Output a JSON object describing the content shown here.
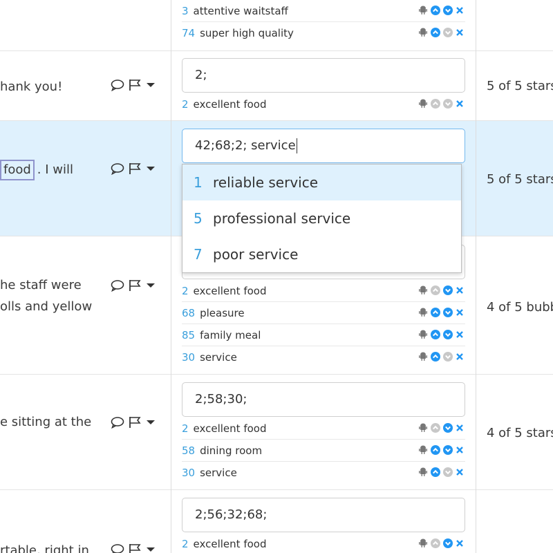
{
  "colors": {
    "accent": "#2196f3",
    "number": "#3a9fdc",
    "highlight_row": "#dff1fd",
    "disabled": "#c8c8c8",
    "remove": "#2196f3"
  },
  "top_tags": [
    {
      "num": "3",
      "label": "attentive waitstaff",
      "up": true,
      "down": true
    },
    {
      "num": "74",
      "label": "super high quality",
      "up": true,
      "down": false
    }
  ],
  "rows": [
    {
      "review_lines": [
        "hank you!"
      ],
      "input_value": "2;",
      "tags": [
        {
          "num": "2",
          "label": "excellent food",
          "up": false,
          "down": false
        }
      ],
      "rating": "5 of 5 stars"
    },
    {
      "review_lines": [
        "food",
        ". I will"
      ],
      "input_value": "42;68;2; service",
      "tags": [],
      "rating": "5 of 5 stars"
    },
    {
      "review_lines": [
        "he staff were",
        "olls and yellow"
      ],
      "input_value": "",
      "tags": [
        {
          "num": "2",
          "label": "excellent food",
          "up": false,
          "down": true
        },
        {
          "num": "68",
          "label": "pleasure",
          "up": true,
          "down": true
        },
        {
          "num": "85",
          "label": "family meal",
          "up": true,
          "down": true
        },
        {
          "num": "30",
          "label": "service",
          "up": true,
          "down": false
        }
      ],
      "rating": "4 of 5 bubb"
    },
    {
      "review_lines": [
        "e sitting at the"
      ],
      "input_value": "2;58;30;",
      "tags": [
        {
          "num": "2",
          "label": "excellent food",
          "up": false,
          "down": true
        },
        {
          "num": "58",
          "label": "dining room",
          "up": true,
          "down": true
        },
        {
          "num": "30",
          "label": "service",
          "up": true,
          "down": false
        }
      ],
      "rating": "4 of 5 stars"
    },
    {
      "review_lines": [
        "rtable, right in"
      ],
      "input_value": "2;56;32;68;",
      "tags": [
        {
          "num": "2",
          "label": "excellent food",
          "up": false,
          "down": true
        }
      ],
      "rating": ""
    }
  ],
  "autocomplete": [
    {
      "num": "1",
      "label": "reliable service"
    },
    {
      "num": "5",
      "label": "professional service"
    },
    {
      "num": "7",
      "label": "poor service"
    }
  ]
}
